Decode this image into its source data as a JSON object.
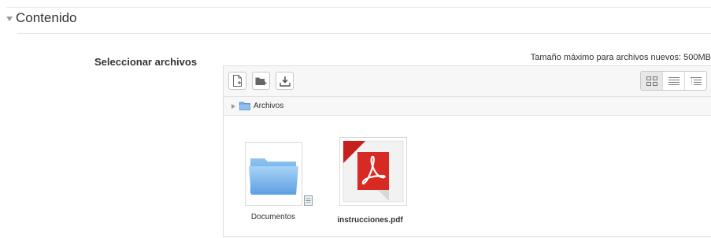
{
  "section": {
    "title": "Contenido"
  },
  "field": {
    "label": "Seleccionar archivos"
  },
  "filepicker": {
    "max_size_text": "Tamaño máximo para archivos nuevos: 500MB",
    "toolbar": {
      "buttons": [
        {
          "icon": "add-file-icon"
        },
        {
          "icon": "create-folder-icon"
        },
        {
          "icon": "download-icon"
        }
      ],
      "views": [
        {
          "icon": "icons-view-icon",
          "active": true
        },
        {
          "icon": "list-view-icon",
          "active": false
        },
        {
          "icon": "tree-view-icon",
          "active": false
        }
      ]
    },
    "path": {
      "root_label": "Archivos"
    },
    "items": [
      {
        "name": "Documentos",
        "type": "folder",
        "icon": "folder-icon"
      },
      {
        "name": "instrucciones.pdf",
        "type": "pdf",
        "icon": "pdf-icon"
      }
    ]
  },
  "colors": {
    "folder": "#6aa8e6",
    "pdf_red": "#c8201f"
  }
}
